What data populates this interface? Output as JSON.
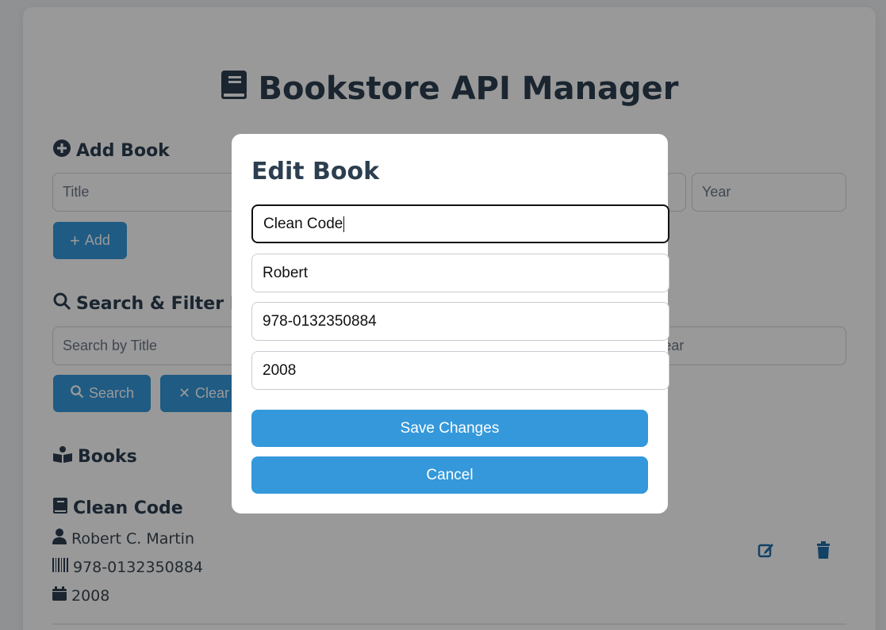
{
  "app": {
    "title": "Bookstore API Manager"
  },
  "add_section": {
    "title": "Add Book",
    "title_placeholder": "Title",
    "year_placeholder": "Year",
    "add_button": "Add"
  },
  "search_section": {
    "title": "Search & Filter Books",
    "search_placeholder": "Search by Title",
    "year_placeholder": "Year",
    "search_button": "Search",
    "clear_button": "Clear"
  },
  "books_section": {
    "title": "Books",
    "items": [
      {
        "title": "Clean Code",
        "author": "Robert C. Martin",
        "isbn": "978-0132350884",
        "year": "2008"
      }
    ]
  },
  "modal": {
    "title": "Edit Book",
    "title_value": "Clean Code",
    "author_value": "Robert",
    "isbn_value": "978-0132350884",
    "year_value": "2008",
    "save_button": "Save Changes",
    "cancel_button": "Cancel"
  },
  "colors": {
    "accent": "#3498db",
    "heading": "#2c3e50",
    "overlay": "rgba(0,0,0,0.4)"
  }
}
